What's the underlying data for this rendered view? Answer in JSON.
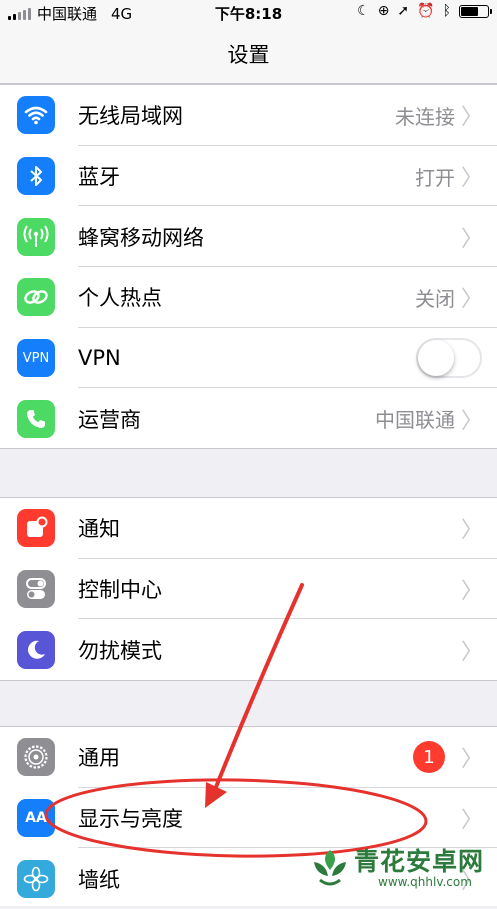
{
  "status_bar": {
    "carrier": "中国联通",
    "network": "4G",
    "time": "下午8:18",
    "battery_level": 0.7
  },
  "nav": {
    "title": "设置"
  },
  "group1": [
    {
      "label": "无线局域网",
      "value": "未连接",
      "icon": "wifi-icon",
      "color": "#147efb"
    },
    {
      "label": "蓝牙",
      "value": "打开",
      "icon": "bluetooth-icon",
      "color": "#147efb"
    },
    {
      "label": "蜂窝移动网络",
      "value": "",
      "icon": "cellular-icon",
      "color": "#4cd964"
    },
    {
      "label": "个人热点",
      "value": "关闭",
      "icon": "hotspot-icon",
      "color": "#4cd964"
    },
    {
      "label": "VPN",
      "value": "",
      "icon": "vpn-icon",
      "icon_text": "VPN",
      "color": "#147efb",
      "toggle_on": false
    },
    {
      "label": "运营商",
      "value": "中国联通",
      "icon": "phone-icon",
      "color": "#4cd964"
    }
  ],
  "group2": [
    {
      "label": "通知",
      "icon": "notifications-icon",
      "color": "#ff3b30"
    },
    {
      "label": "控制中心",
      "icon": "control-center-icon",
      "color": "#8e8e93"
    },
    {
      "label": "勿扰模式",
      "icon": "moon-icon",
      "color": "#5856d6"
    }
  ],
  "group3": [
    {
      "label": "通用",
      "icon": "gear-icon",
      "color": "#8e8e93",
      "badge": "1"
    },
    {
      "label": "显示与亮度",
      "icon": "display-icon",
      "icon_text": "AA",
      "color": "#147efb"
    },
    {
      "label": "墙纸",
      "icon": "wallpaper-icon",
      "color": "#34aadc"
    }
  ],
  "watermark": {
    "name": "青花安卓网",
    "url": "www.qhhlv.com"
  }
}
